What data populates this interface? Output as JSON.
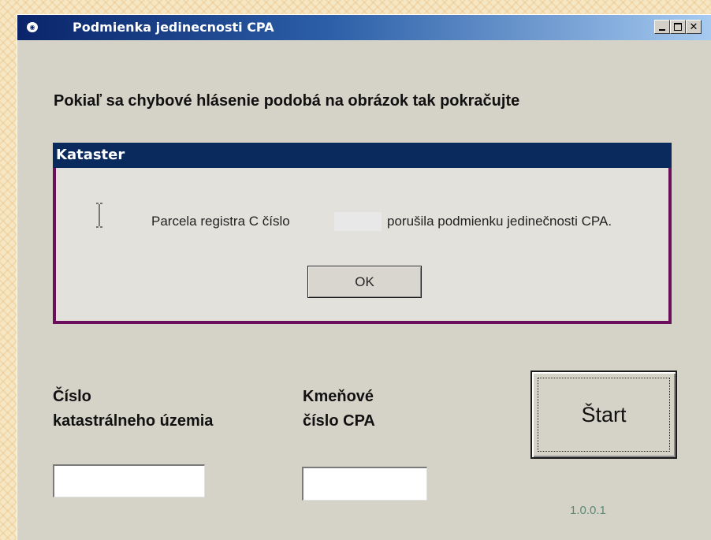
{
  "window": {
    "title": "Podmienka jedinecnosti CPA",
    "icon": "app-icon",
    "controls": [
      "minimize-icon",
      "maximize-icon",
      "close-icon"
    ],
    "close_glyph": "✕"
  },
  "instruction": "Pokiaľ sa chybové hlásenie podobá na obrázok tak pokračujte",
  "error_sample": {
    "title": "Kataster",
    "message_part1": "Parcela registra C číslo",
    "message_part2": "porušila podmienku jedinečnosti CPA.",
    "ok_label": "OK",
    "cursor_icon": "text-cursor-icon"
  },
  "form": {
    "territory_label_line1": "Číslo",
    "territory_label_line2": "katastrálneho územia",
    "territory_value": "",
    "cpa_label_line1": "Kmeňové",
    "cpa_label_line2": "číslo CPA",
    "cpa_value": "",
    "start_label": "Štart"
  },
  "version": "1.0.0.1",
  "colors": {
    "title_bar": "#0a246a",
    "error_header": "#0a2a5e",
    "error_border": "#6b0f5c",
    "window_bg": "#d5d2c7",
    "version_text": "#5a8a72"
  }
}
